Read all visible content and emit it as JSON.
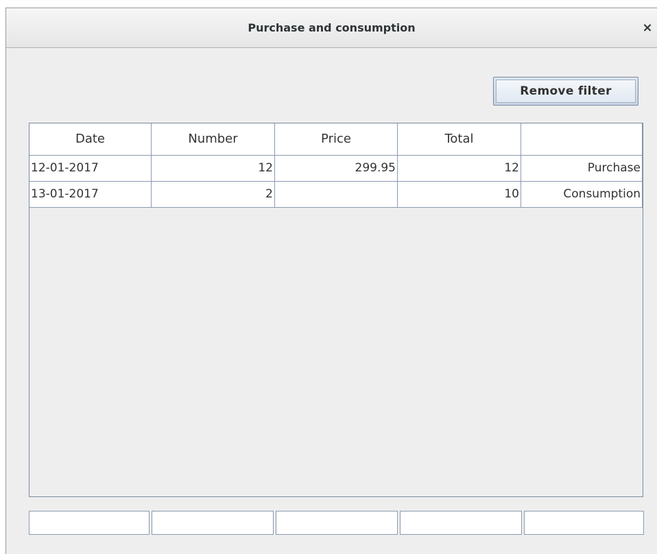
{
  "window": {
    "title": "Purchase and consumption",
    "close_icon": "close-icon",
    "close_glyph": "×"
  },
  "toolbar": {
    "remove_filter_label": "Remove filter"
  },
  "table": {
    "columns": [
      "Date",
      "Number",
      "Price",
      "Total",
      ""
    ],
    "rows": [
      {
        "date": "12-01-2017",
        "number": "12",
        "price": "299.95",
        "total": "12",
        "type": "Purchase"
      },
      {
        "date": "13-01-2017",
        "number": "2",
        "price": "",
        "total": "10",
        "type": "Consumption"
      }
    ]
  },
  "filters": [
    "",
    "",
    "",
    "",
    ""
  ],
  "colors": {
    "window_bg": "#eeeeee",
    "grid_line": "#8a9ab0",
    "button_bg": "#e1e9f3",
    "text": "#333333"
  }
}
